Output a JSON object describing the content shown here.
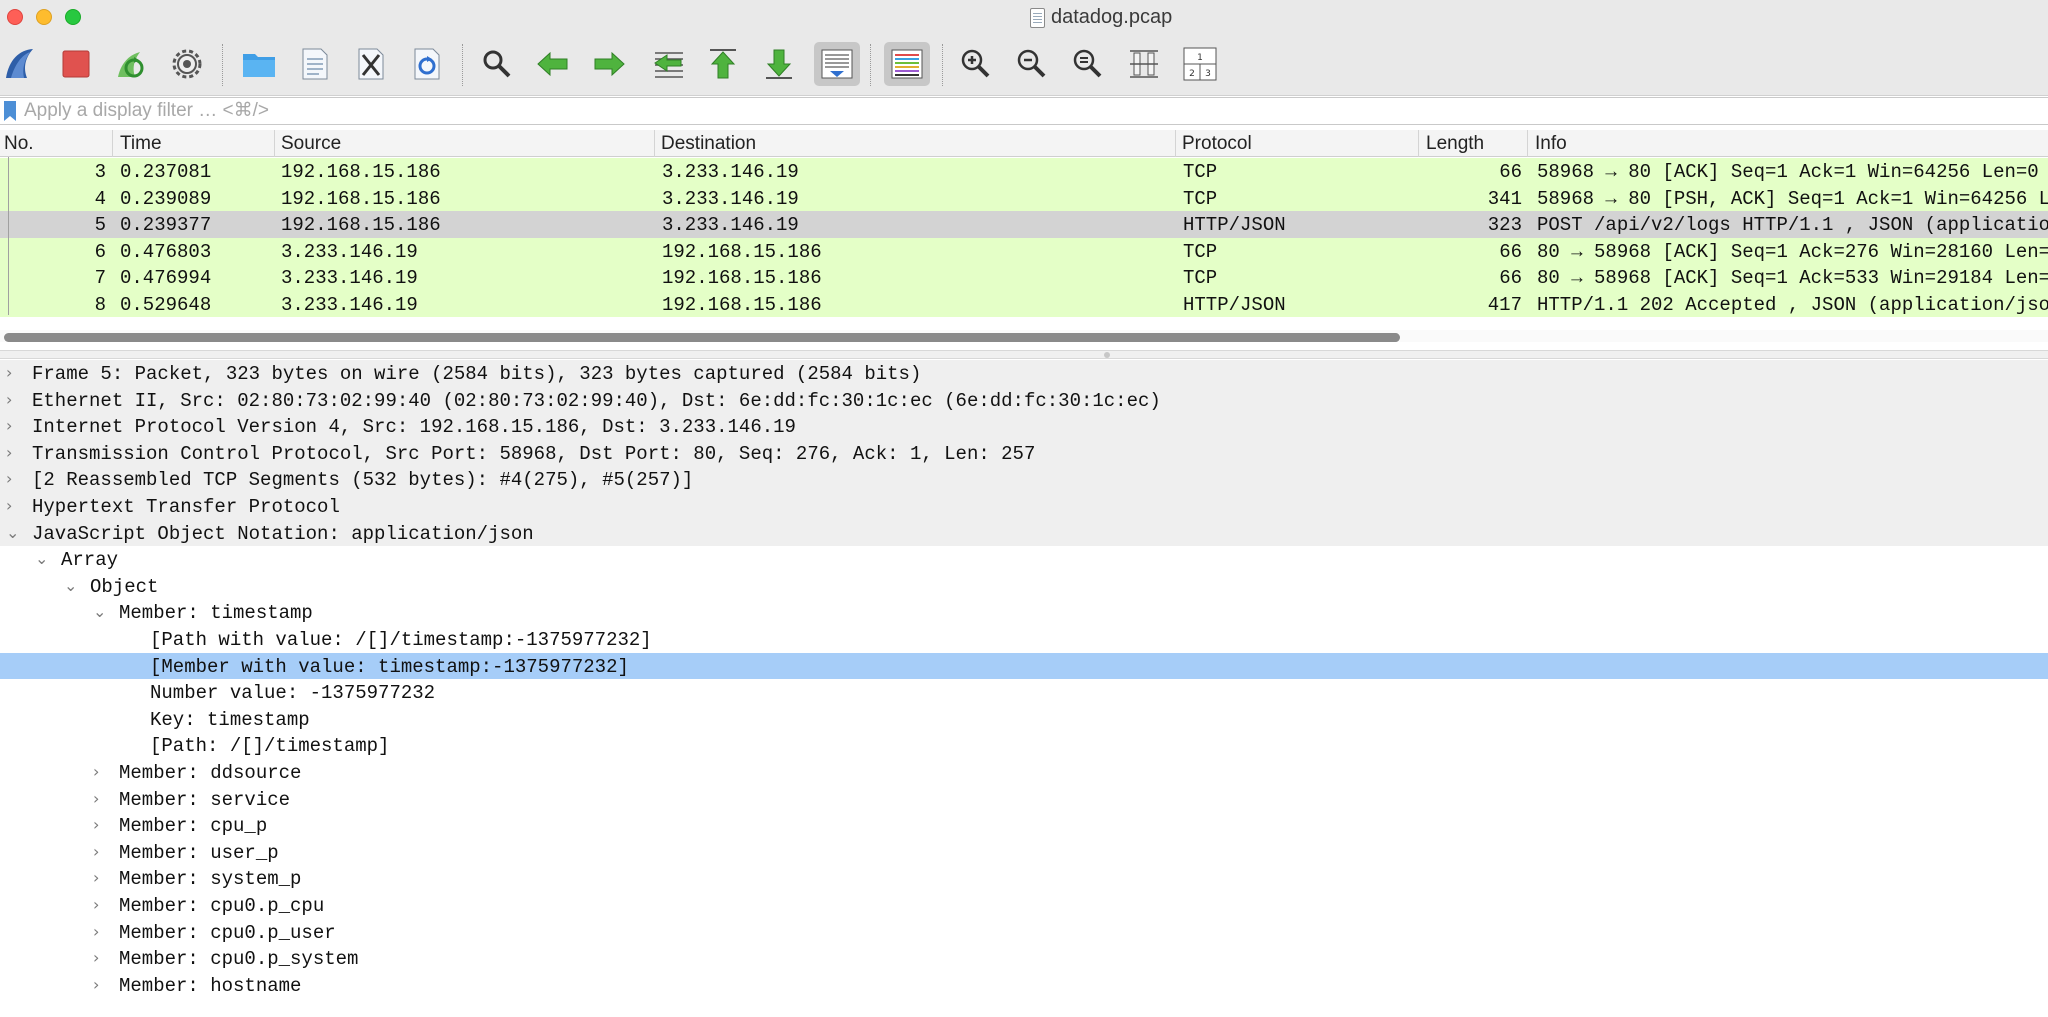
{
  "window": {
    "title": "datadog.pcap"
  },
  "toolbar": {
    "buttons": [
      {
        "icon": "shark-fin-start-icon"
      },
      {
        "icon": "stop-square-icon"
      },
      {
        "icon": "restart-capture-icon"
      },
      {
        "icon": "capture-options-gear-icon"
      },
      {
        "icon": "open-folder-icon"
      },
      {
        "icon": "save-file-icon"
      },
      {
        "icon": "close-file-icon"
      },
      {
        "icon": "reload-icon"
      },
      {
        "icon": "find-packet-icon"
      },
      {
        "icon": "go-back-arrow-icon"
      },
      {
        "icon": "go-forward-arrow-icon"
      },
      {
        "icon": "go-to-packet-icon"
      },
      {
        "icon": "first-packet-icon"
      },
      {
        "icon": "last-packet-icon"
      },
      {
        "icon": "auto-scroll-icon"
      },
      {
        "icon": "colorize-icon"
      },
      {
        "icon": "zoom-in-icon"
      },
      {
        "icon": "zoom-out-icon"
      },
      {
        "icon": "normal-size-icon"
      },
      {
        "icon": "resize-columns-icon"
      },
      {
        "icon": "layout-panes-icon"
      }
    ],
    "layout_digits": [
      "1",
      "2",
      "3"
    ]
  },
  "filter": {
    "placeholder": "Apply a display filter … <⌘/>",
    "value": ""
  },
  "packet_list": {
    "columns": [
      "No.",
      "Time",
      "Source",
      "Destination",
      "Protocol",
      "Length",
      "Info"
    ],
    "rows": [
      {
        "no": "3",
        "time": "0.237081",
        "source": "192.168.15.186",
        "destination": "3.233.146.19",
        "protocol": "TCP",
        "length": "66",
        "info": "58968 → 80 [ACK] Seq=1 Ack=1 Win=64256 Len=0",
        "selected": false
      },
      {
        "no": "4",
        "time": "0.239089",
        "source": "192.168.15.186",
        "destination": "3.233.146.19",
        "protocol": "TCP",
        "length": "341",
        "info": "58968 → 80 [PSH, ACK] Seq=1 Ack=1 Win=64256 L",
        "selected": false
      },
      {
        "no": "5",
        "time": "0.239377",
        "source": "192.168.15.186",
        "destination": "3.233.146.19",
        "protocol": "HTTP/JSON",
        "length": "323",
        "info": "POST /api/v2/logs HTTP/1.1 , JSON (applicatio",
        "selected": true
      },
      {
        "no": "6",
        "time": "0.476803",
        "source": "3.233.146.19",
        "destination": "192.168.15.186",
        "protocol": "TCP",
        "length": "66",
        "info": "80 → 58968 [ACK] Seq=1 Ack=276 Win=28160 Len=",
        "selected": false
      },
      {
        "no": "7",
        "time": "0.476994",
        "source": "3.233.146.19",
        "destination": "192.168.15.186",
        "protocol": "TCP",
        "length": "66",
        "info": "80 → 58968 [ACK] Seq=1 Ack=533 Win=29184 Len=",
        "selected": false
      },
      {
        "no": "8",
        "time": "0.529648",
        "source": "3.233.146.19",
        "destination": "192.168.15.186",
        "protocol": "HTTP/JSON",
        "length": "417",
        "info": "HTTP/1.1 202 Accepted , JSON (application/jso",
        "selected": false
      }
    ]
  },
  "details": {
    "rows": [
      {
        "level": 0,
        "expander": "collapsed",
        "text": "Frame 5: Packet, 323 bytes on wire (2584 bits), 323 bytes captured (2584 bits)"
      },
      {
        "level": 0,
        "expander": "collapsed",
        "text": "Ethernet II, Src: 02:80:73:02:99:40 (02:80:73:02:99:40), Dst: 6e:dd:fc:30:1c:ec (6e:dd:fc:30:1c:ec)"
      },
      {
        "level": 0,
        "expander": "collapsed",
        "text": "Internet Protocol Version 4, Src: 192.168.15.186, Dst: 3.233.146.19"
      },
      {
        "level": 0,
        "expander": "collapsed",
        "text": "Transmission Control Protocol, Src Port: 58968, Dst Port: 80, Seq: 276, Ack: 1, Len: 257"
      },
      {
        "level": 0,
        "expander": "collapsed",
        "text": "[2 Reassembled TCP Segments (532 bytes): #4(275), #5(257)]"
      },
      {
        "level": 0,
        "expander": "collapsed",
        "text": "Hypertext Transfer Protocol"
      },
      {
        "level": 0,
        "expander": "expanded",
        "text": "JavaScript Object Notation: application/json"
      },
      {
        "level": 1,
        "expander": "expanded",
        "text": "Array"
      },
      {
        "level": 2,
        "expander": "expanded",
        "text": "Object"
      },
      {
        "level": 3,
        "expander": "expanded",
        "text": "Member: timestamp"
      },
      {
        "level": 4,
        "expander": "none",
        "text": "[Path with value: /[]/timestamp:-1375977232]"
      },
      {
        "level": 4,
        "expander": "none",
        "text": "[Member with value: timestamp:-1375977232]",
        "highlight": true
      },
      {
        "level": 4,
        "expander": "none",
        "text": "Number value: -1375977232"
      },
      {
        "level": 4,
        "expander": "none",
        "text": "Key: timestamp"
      },
      {
        "level": 4,
        "expander": "none",
        "text": "[Path: /[]/timestamp]"
      },
      {
        "level": 3,
        "expander": "collapsed",
        "text": "Member: ddsource"
      },
      {
        "level": 3,
        "expander": "collapsed",
        "text": "Member: service"
      },
      {
        "level": 3,
        "expander": "collapsed",
        "text": "Member: cpu_p"
      },
      {
        "level": 3,
        "expander": "collapsed",
        "text": "Member: user_p"
      },
      {
        "level": 3,
        "expander": "collapsed",
        "text": "Member: system_p"
      },
      {
        "level": 3,
        "expander": "collapsed",
        "text": "Member: cpu0.p_cpu"
      },
      {
        "level": 3,
        "expander": "collapsed",
        "text": "Member: cpu0.p_user"
      },
      {
        "level": 3,
        "expander": "collapsed",
        "text": "Member: cpu0.p_system"
      },
      {
        "level": 3,
        "expander": "collapsed",
        "text": "Member: hostname"
      }
    ]
  },
  "colors": {
    "tcp_row": "#e4ffc7",
    "selected_row": "#d3d3d3",
    "detail_highlight": "#a6cdf8",
    "top_level_bg": "#efefef"
  }
}
